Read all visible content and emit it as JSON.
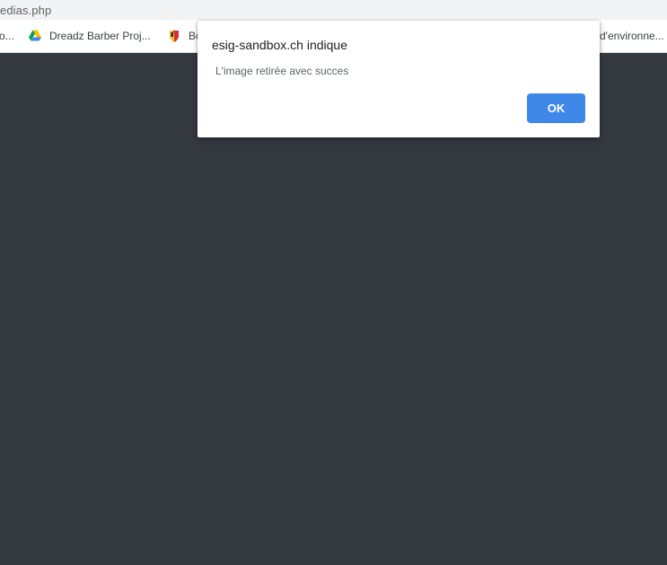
{
  "browser": {
    "address": "ledias.php",
    "bookmarks": [
      {
        "label": "o...",
        "icon": "bookmark-icon"
      },
      {
        "label": "Dreadz Barber Proj...",
        "icon": "google-drive-icon"
      },
      {
        "label": "Bo",
        "icon": "geneva-crest-icon"
      },
      {
        "label": "d'environne...",
        "icon": ""
      }
    ]
  },
  "dialog": {
    "title": "esig-sandbox.ch indique",
    "message": "L'image retirée avec succes",
    "ok_label": "OK"
  },
  "colors": {
    "page_background": "#34383f",
    "accent_button": "#3f87e9",
    "toolbar_background": "#f1f3f4"
  }
}
